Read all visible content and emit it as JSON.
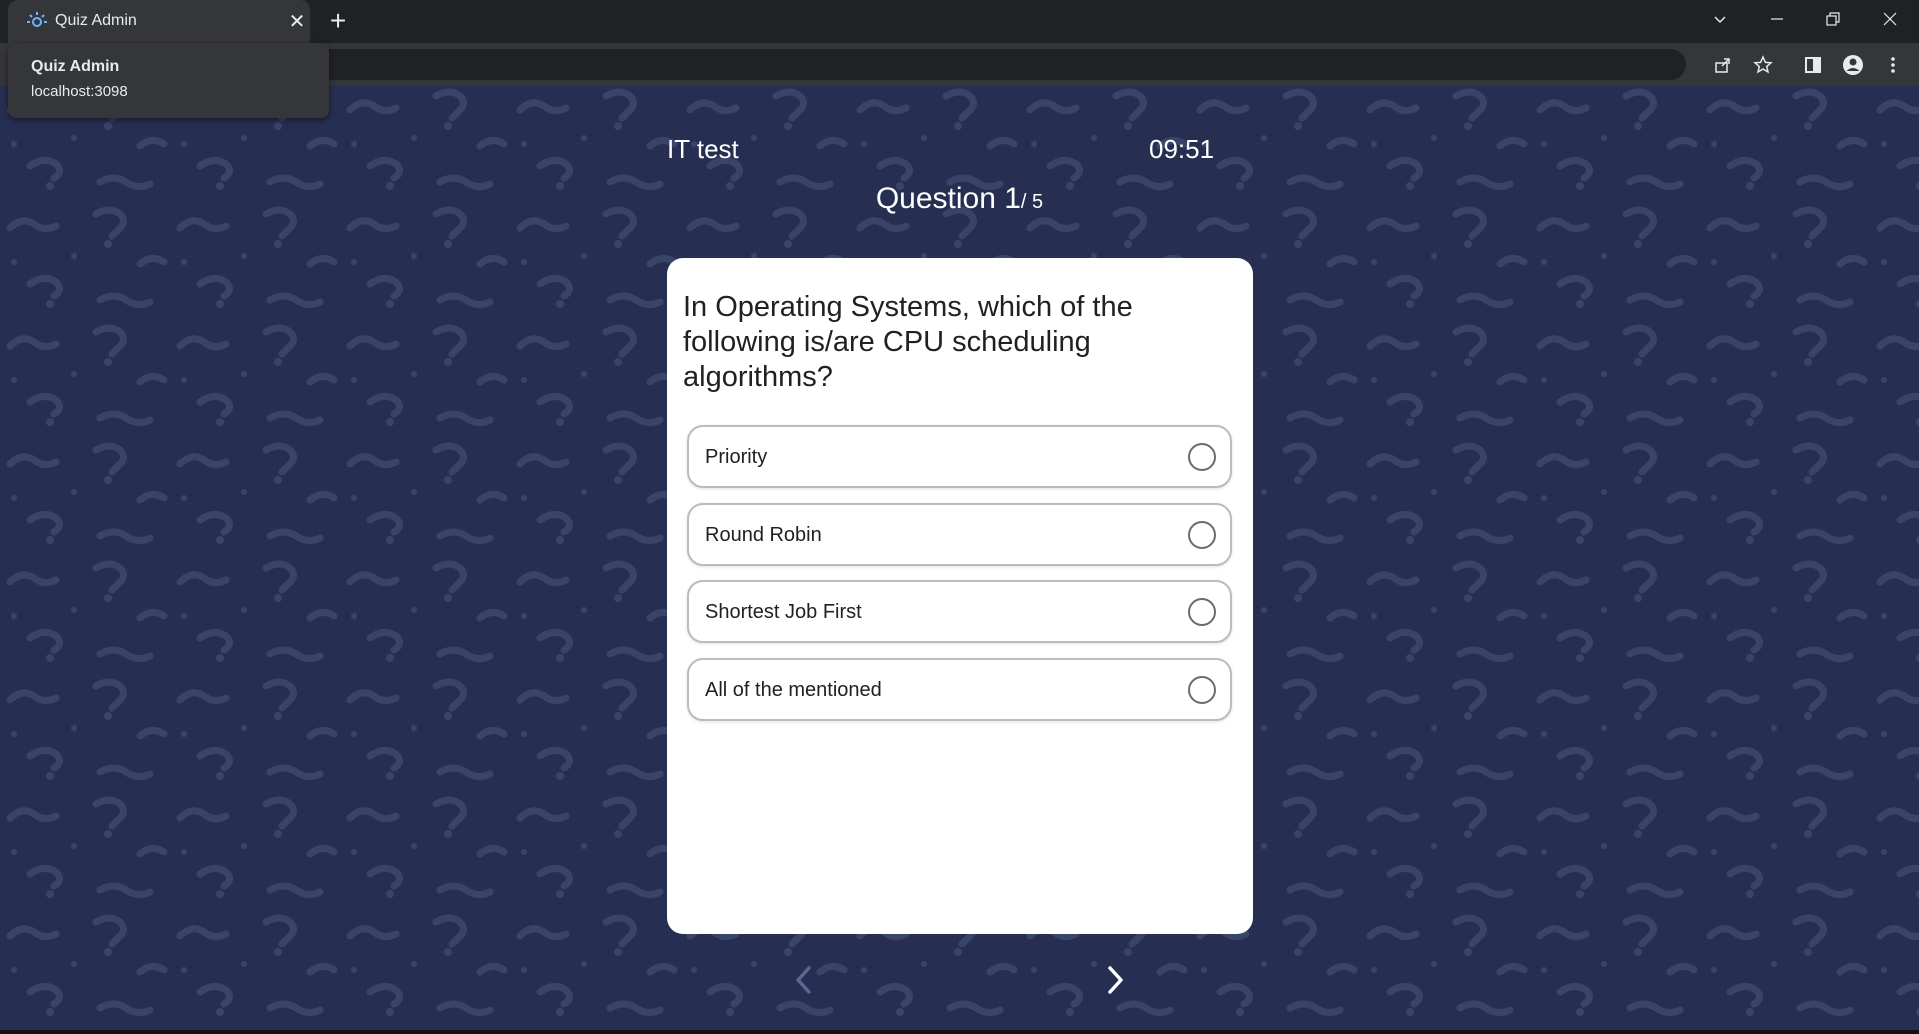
{
  "browser": {
    "tab_title": "Quiz Admin",
    "hover_card": {
      "title": "Quiz Admin",
      "url": "localhost:3098"
    },
    "new_tab_symbol": "+",
    "close_symbol": "✕",
    "window_controls": [
      "tab-search",
      "minimize",
      "restore",
      "close"
    ]
  },
  "quiz": {
    "name": "IT test",
    "timer": "09:51",
    "question_label": "Question 1",
    "question_total": "/ 5",
    "question_text": "In Operating Systems, which of the following is/are CPU scheduling algorithms?",
    "options": [
      {
        "label": "Priority"
      },
      {
        "label": "Round Robin"
      },
      {
        "label": "Shortest Job First"
      },
      {
        "label": "All of the mentioned"
      }
    ]
  },
  "colors": {
    "page_background": "#262f52",
    "pattern_color": "#3a4468",
    "card_background": "#ffffff"
  }
}
